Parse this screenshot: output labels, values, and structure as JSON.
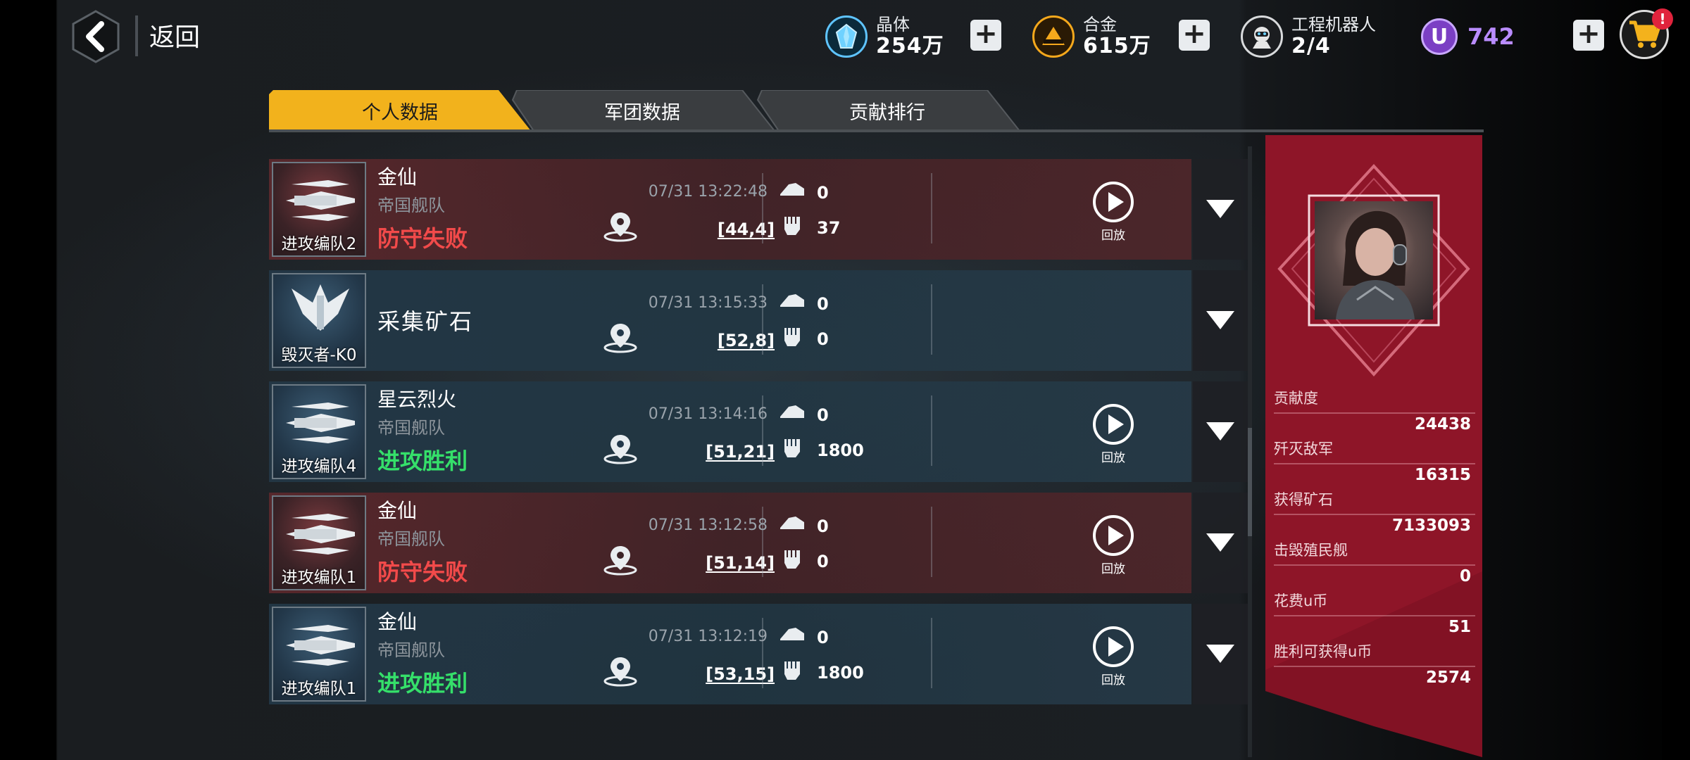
{
  "header": {
    "back_label": "返回",
    "resources": [
      {
        "name": "晶体",
        "value": "254万",
        "icon": "crystal-icon"
      },
      {
        "name": "合金",
        "value": "615万",
        "icon": "alloy-icon"
      },
      {
        "name": "工程机器人",
        "value": "2/4",
        "icon": "robot-icon"
      }
    ],
    "ucoin": {
      "symbol": "U",
      "value": "742"
    },
    "cart_badge": "!"
  },
  "tabs": [
    {
      "label": "个人数据",
      "active": true
    },
    {
      "label": "军团数据",
      "active": false
    },
    {
      "label": "贡献排行",
      "active": false
    }
  ],
  "records": [
    {
      "fleet": "进攻编队2",
      "name": "金仙",
      "sub": "帝国舰队",
      "result": "防守失败",
      "result_color": "#f24a4a",
      "time": "07/31 13:22:48",
      "coord": "[44,4]",
      "stat1": "0",
      "stat2": "37",
      "replay": "回放",
      "theme": "red"
    },
    {
      "fleet": "毁灭者-K0",
      "name": "采集矿石",
      "sub": "",
      "result": "",
      "result_color": "",
      "time": "07/31 13:15:33",
      "coord": "[52,8]",
      "stat1": "0",
      "stat2": "0",
      "replay": "",
      "theme": "blue"
    },
    {
      "fleet": "进攻编队4",
      "name": "星云烈火",
      "sub": "帝国舰队",
      "result": "进攻胜利",
      "result_color": "#35e06a",
      "time": "07/31 13:14:16",
      "coord": "[51,21]",
      "stat1": "0",
      "stat2": "1800",
      "replay": "回放",
      "theme": "blue"
    },
    {
      "fleet": "进攻编队1",
      "name": "金仙",
      "sub": "帝国舰队",
      "result": "防守失败",
      "result_color": "#f24a4a",
      "time": "07/31 13:12:58",
      "coord": "[51,14]",
      "stat1": "0",
      "stat2": "0",
      "replay": "回放",
      "theme": "red"
    },
    {
      "fleet": "进攻编队1",
      "name": "金仙",
      "sub": "帝国舰队",
      "result": "进攻胜利",
      "result_color": "#35e06a",
      "time": "07/31 13:12:19",
      "coord": "[53,15]",
      "stat1": "0",
      "stat2": "1800",
      "replay": "回放",
      "theme": "blue"
    }
  ],
  "panel": {
    "stats": [
      {
        "label": "贡献度",
        "value": "24438"
      },
      {
        "label": "歼灭敌军",
        "value": "16315"
      },
      {
        "label": "获得矿石",
        "value": "7133093"
      },
      {
        "label": "击毁殖民舰",
        "value": "0"
      },
      {
        "label": "花费u币",
        "value": "51"
      },
      {
        "label": "胜利可获得u币",
        "value": "2574"
      }
    ]
  },
  "colors": {
    "accent": "#f2b21c",
    "panel": "#8e1528",
    "defeat": "#f24a4a",
    "victory": "#35e06a",
    "ucoin": "#b98cff"
  }
}
